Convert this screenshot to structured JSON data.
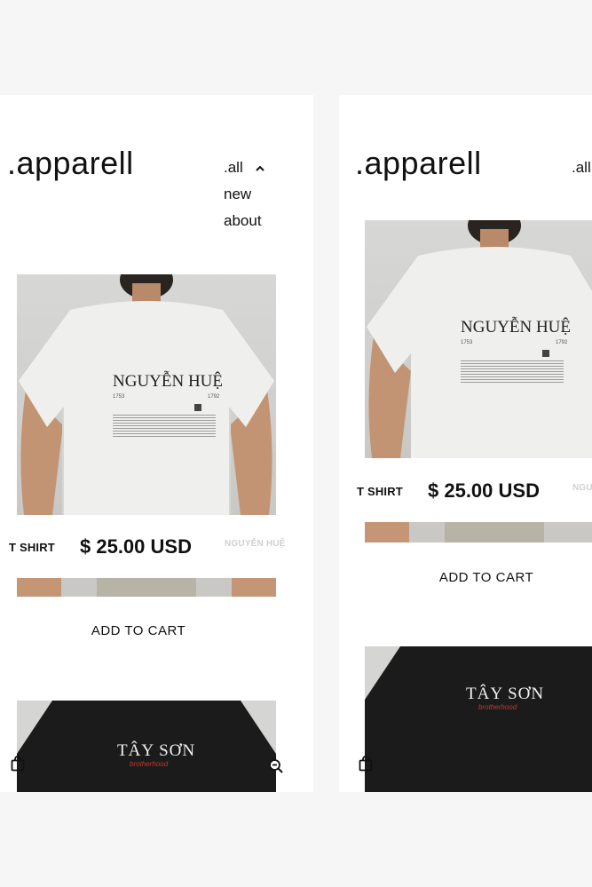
{
  "brand": ".apparell",
  "nav": {
    "items": [
      {
        "label": ".all",
        "icon": "chevron-up-icon"
      },
      {
        "label": "new"
      },
      {
        "label": "about"
      }
    ]
  },
  "products": [
    {
      "type_label": "T SHIRT",
      "price": "$ 25.00 USD",
      "name": "NGUYỄN HUỆ",
      "cta": "ADD TO CART",
      "print": {
        "title": "NGUYỄN HUỆ",
        "years_left": "1753",
        "years_right": "1792"
      }
    },
    {
      "print": {
        "title": "TÂY SƠN",
        "subtitle": "brotherhood"
      }
    }
  ],
  "preview2": {
    "brand": ".apparell",
    "nav_label": ".all",
    "type_label": "T SHIRT",
    "price": "$ 25.00 USD",
    "name_partial": "NGU",
    "cta": "ADD TO CART"
  },
  "icons": {
    "cart": "shopping-bag-icon",
    "zoom": "zoom-out-icon"
  },
  "colors": {
    "page_bg": "#f6f6f7",
    "card_bg": "#ffffff",
    "accent_red": "#c0392b"
  }
}
